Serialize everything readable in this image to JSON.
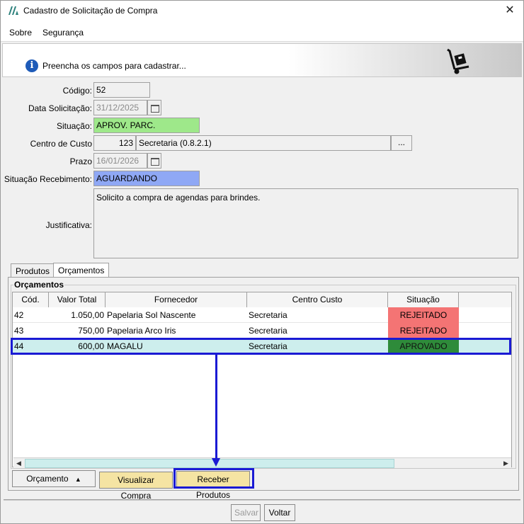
{
  "window": {
    "title": "Cadastro de Solicitação de Compra",
    "close_label": "✕"
  },
  "menu": {
    "items": [
      {
        "label": "Sobre"
      },
      {
        "label": "Segurança"
      }
    ]
  },
  "header": {
    "info_text": "Preencha os campos para cadastrar..."
  },
  "form": {
    "codigo_label": "Código:",
    "codigo_value": "52",
    "data_label": "Data Solicitação:",
    "data_value": "31/12/2025",
    "situacao_label": "Situação:",
    "situacao_value": "APROV. PARC.",
    "centro_label": "Centro de Custo",
    "centro_code": "123",
    "centro_name": "Secretaria (0.8.2.1)",
    "centro_button": "...",
    "prazo_label": "Prazo",
    "prazo_value": "16/01/2026",
    "recebimento_label": "Situação Recebimento:",
    "recebimento_value": "AGUARDANDO",
    "justificativa_label": "Justificativa:",
    "justificativa_value": "Solicito a compra de agendas para brindes."
  },
  "tabs": [
    {
      "label": "Produtos"
    },
    {
      "label": "Orçamentos"
    }
  ],
  "orcamentos": {
    "group_label": "Orçamentos",
    "columns": [
      "Cód.",
      "Valor Total",
      "Fornecedor",
      "Centro Custo",
      "Situação"
    ],
    "rows": [
      {
        "cod": "42",
        "valor": "1.050,00",
        "fornecedor": "Papelaria Sol Nascente",
        "centro": "Secretaria",
        "situacao": "REJEITADO"
      },
      {
        "cod": "43",
        "valor": "750,00",
        "fornecedor": "Papelaria Arco Iris",
        "centro": "Secretaria",
        "situacao": "REJEITADO"
      },
      {
        "cod": "44",
        "valor": "600,00",
        "fornecedor": "MAGALU",
        "centro": "Secretaria",
        "situacao": "APROVADO"
      }
    ],
    "status_colors": {
      "REJEITADO": "#f47474",
      "APROVADO": "#2e8b3a"
    }
  },
  "buttons": {
    "orcamento": "Orçamento",
    "visualizar": "Visualizar Compra",
    "receber": "Receber Produtos",
    "salvar": "Salvar",
    "voltar": "Voltar"
  }
}
